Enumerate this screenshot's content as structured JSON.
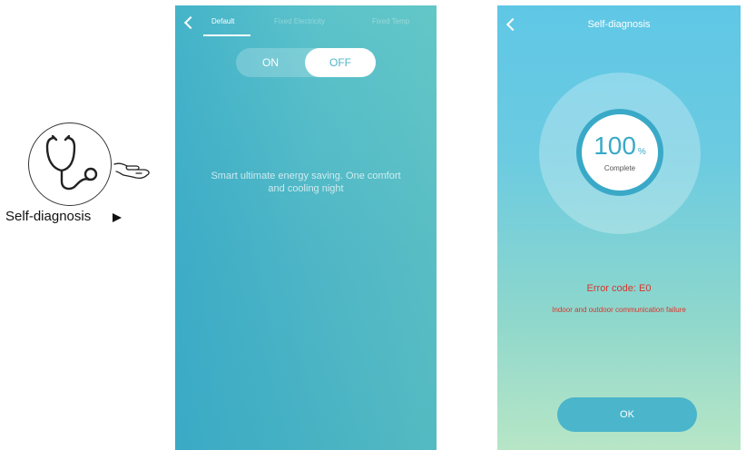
{
  "illustration": {
    "label": "Self-diagnosis",
    "icons": [
      "stethoscope-icon",
      "hand-pointer-icon",
      "cursor-arrow-icon"
    ]
  },
  "screen1": {
    "tabs": [
      "Default",
      "Fixed Electricity",
      "Fixed Temp"
    ],
    "active_tab": "Default",
    "toggle": {
      "on_label": "ON",
      "off_label": "OFF",
      "selected": "OFF"
    },
    "description": "Smart ultimate energy saving. One comfort and cooling night"
  },
  "screen2": {
    "title": "Self-diagnosis",
    "progress_value": "100",
    "progress_unit": "%",
    "progress_fraction": 1.0,
    "progress_label": "Complete",
    "error_code": "Error code: E0",
    "error_message": "Indoor and outdoor communication failure",
    "ok_label": "OK"
  },
  "colors": {
    "accent": "#3aa9c8",
    "error": "#d9352b",
    "button": "#4ab5cb"
  }
}
